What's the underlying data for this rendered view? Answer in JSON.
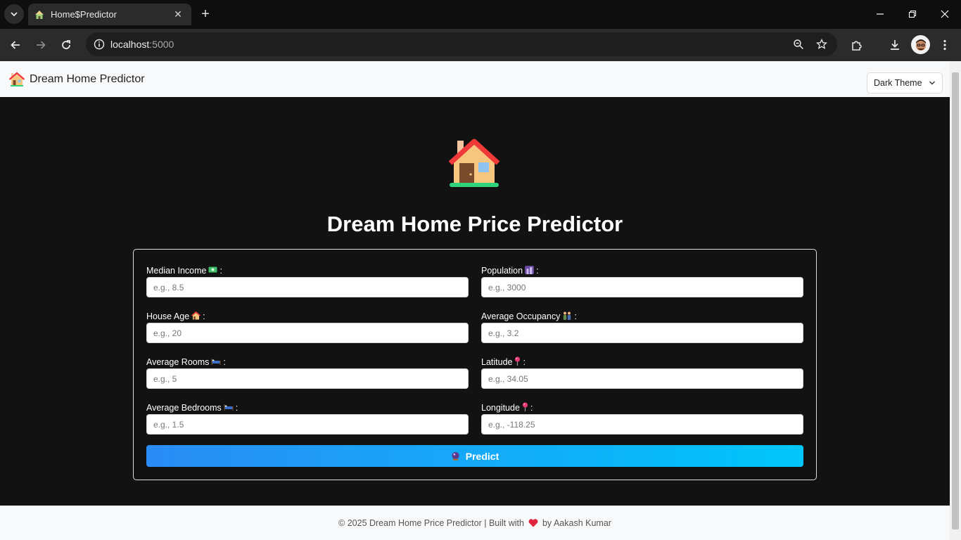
{
  "browser": {
    "tab_title": "Home$Predictor",
    "url_host": "localhost",
    "url_port": ":5000"
  },
  "header": {
    "brand": "Dream Home Predictor",
    "theme_select": "Dark Theme"
  },
  "main": {
    "title": "Dream Home Price Predictor",
    "fields": [
      {
        "label": "Median Income",
        "placeholder": "e.g., 8.5",
        "icon": "money-icon"
      },
      {
        "label": "Population",
        "placeholder": "e.g., 3000",
        "icon": "city-icon"
      },
      {
        "label": "House Age",
        "placeholder": "e.g., 20",
        "icon": "house-icon"
      },
      {
        "label": "Average Occupancy",
        "placeholder": "e.g., 3.2",
        "icon": "people-icon"
      },
      {
        "label": "Average Rooms",
        "placeholder": "e.g., 5",
        "icon": "bed-icon"
      },
      {
        "label": "Latitude",
        "placeholder": "e.g., 34.05",
        "icon": "pin-icon"
      },
      {
        "label": "Average Bedrooms",
        "placeholder": "e.g., 1.5",
        "icon": "bed-icon"
      },
      {
        "label": "Longitude",
        "placeholder": "e.g., -118.25",
        "icon": "pin-icon"
      }
    ],
    "predict_label": "Predict"
  },
  "footer": {
    "text_before": "© 2025 Dream Home Price Predictor | Built with",
    "text_after": "by Aakash Kumar"
  },
  "colors": {
    "page_bg": "#121212",
    "button_gradient_start": "#2a8cf5",
    "button_gradient_end": "#00c6fb",
    "heart": "#e0263c"
  }
}
